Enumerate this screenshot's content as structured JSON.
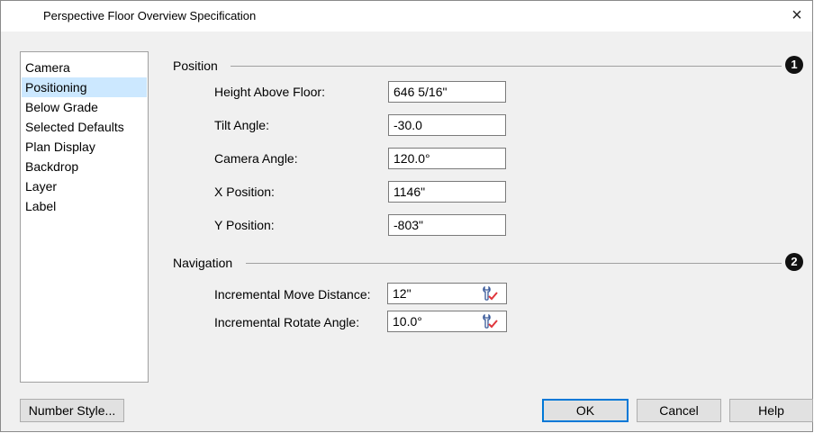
{
  "window": {
    "title": "Perspective Floor Overview Specification",
    "close_glyph": "×"
  },
  "nav": {
    "items": [
      "Camera",
      "Positioning",
      "Below Grade",
      "Selected Defaults",
      "Plan Display",
      "Backdrop",
      "Layer",
      "Label"
    ],
    "selected_index": 1
  },
  "position": {
    "title": "Position",
    "marker": "1",
    "fields": [
      {
        "label": "Height Above Floor:",
        "value": "646 5/16\""
      },
      {
        "label": "Tilt Angle:",
        "value": "-30.0"
      },
      {
        "label": "Camera Angle:",
        "value": "120.0°"
      },
      {
        "label": "X Position:",
        "value": "1146\""
      },
      {
        "label": "Y Position:",
        "value": "-803\""
      }
    ]
  },
  "navigation": {
    "title": "Navigation",
    "marker": "2",
    "fields": [
      {
        "label": "Incremental Move Distance:",
        "value": "12\"",
        "icon": "wrench-check-icon"
      },
      {
        "label": "Incremental Rotate Angle:",
        "value": "10.0°",
        "icon": "wrench-check-icon"
      }
    ]
  },
  "buttons": {
    "number_style": "Number Style...",
    "ok": "OK",
    "cancel": "Cancel",
    "help": "Help"
  },
  "colors": {
    "selection": "#cce8ff",
    "default_button_border": "#0078d7",
    "icon_check": "#e0363c",
    "icon_wrench": "#3a5a9a"
  }
}
